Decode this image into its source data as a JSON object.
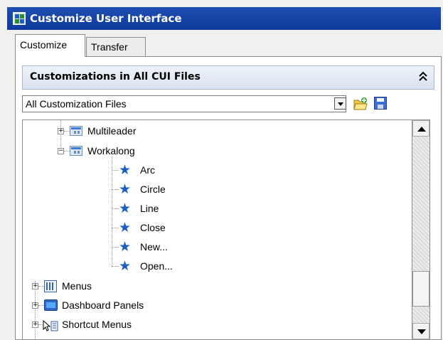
{
  "window": {
    "title": "Customize User Interface",
    "title_icon": "cui-app-icon"
  },
  "tabs": [
    {
      "label": "Customize",
      "active": true
    },
    {
      "label": "Transfer",
      "active": false
    }
  ],
  "section": {
    "title": "Customizations in All CUI Files",
    "collapse_icon": "double-chevron-up-icon",
    "collapse_glyph": "≈"
  },
  "file_select": {
    "value": "All Customization Files",
    "buttons": [
      {
        "name": "open-file-icon"
      },
      {
        "name": "save-file-icon"
      }
    ]
  },
  "tree": {
    "items": [
      {
        "label": "Multileader",
        "icon": "toolbar-icon",
        "expanded": false
      },
      {
        "label": "Workalong",
        "icon": "toolbar-icon",
        "expanded": true
      },
      {
        "label": "Arc",
        "icon": "star-icon"
      },
      {
        "label": "Circle",
        "icon": "star-icon"
      },
      {
        "label": "Line",
        "icon": "star-icon"
      },
      {
        "label": "Close",
        "icon": "star-icon"
      },
      {
        "label": "New...",
        "icon": "star-icon"
      },
      {
        "label": "Open...",
        "icon": "star-icon"
      },
      {
        "label": "Menus",
        "icon": "menu-icon",
        "expanded": false
      },
      {
        "label": "Dashboard Panels",
        "icon": "dashboard-panel-icon",
        "expanded": false
      },
      {
        "label": "Shortcut Menus",
        "icon": "shortcut-menu-icon",
        "expanded": false
      }
    ],
    "expander_collapsed": "+",
    "expander_expanded": "−",
    "star_glyph": "★"
  },
  "colors": {
    "title_bar": "#1f4fb0",
    "star": "#1b5fbf"
  }
}
